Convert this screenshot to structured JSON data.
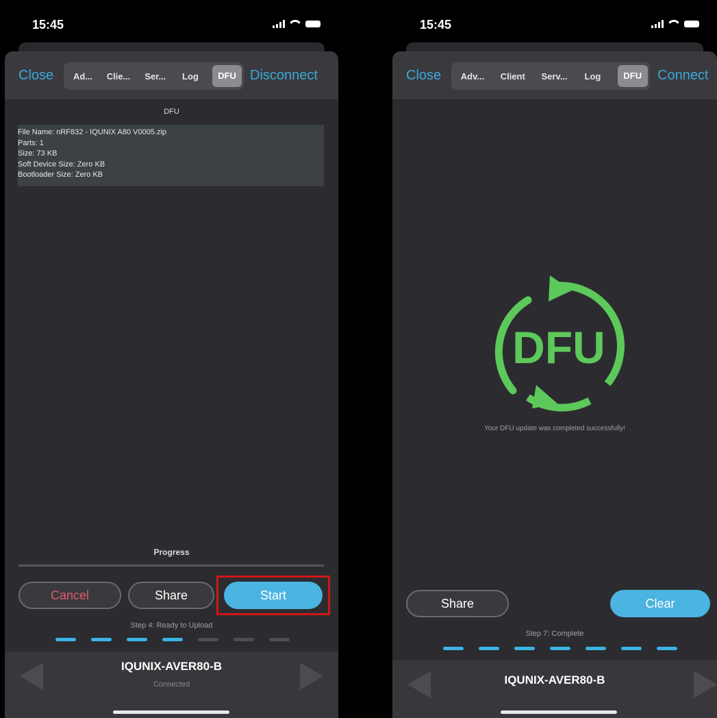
{
  "left_screen": {
    "status": {
      "time": "15:45"
    },
    "nav": {
      "close": "Close",
      "tabs": [
        "Ad...",
        "Clie...",
        "Ser...",
        "Log",
        "DFU"
      ],
      "active_tab": "DFU",
      "action": "Disconnect"
    },
    "dfu_title": "DFU",
    "file_info": [
      "File Name: nRF832 - IQUNIX A80 V0005.zip",
      "Parts: 1",
      "Size: 73 KB",
      "Soft Device Size: Zero KB",
      "Bootloader Size: Zero KB"
    ],
    "progress_label": "Progress",
    "progress_value": 0,
    "buttons": {
      "cancel": "Cancel",
      "share": "Share",
      "start": "Start"
    },
    "step_text": "Step 4: Ready to Upload",
    "steps_total": 7,
    "steps_done": 4,
    "device_name": "IQUNIX-AVER80-B",
    "device_status": "Connected"
  },
  "right_screen": {
    "status": {
      "time": "15:45"
    },
    "nav": {
      "close": "Close",
      "tabs": [
        "Adv...",
        "Client",
        "Serv...",
        "Log",
        "DFU"
      ],
      "active_tab": "DFU",
      "action": "Connect"
    },
    "logo_text": "DFU",
    "success_message": "Your DFU update was completed successfully!",
    "buttons": {
      "share": "Share",
      "clear": "Clear"
    },
    "step_text": "Step 7: Complete",
    "steps_total": 7,
    "steps_done": 7,
    "device_name": "IQUNIX-AVER80-B"
  },
  "colors": {
    "accent": "#3aa8d8",
    "button_fill": "#4bb4e0",
    "cancel_text": "#e05a6a",
    "dfu_logo": "#5cc95a",
    "highlight_box": "#d01616"
  }
}
